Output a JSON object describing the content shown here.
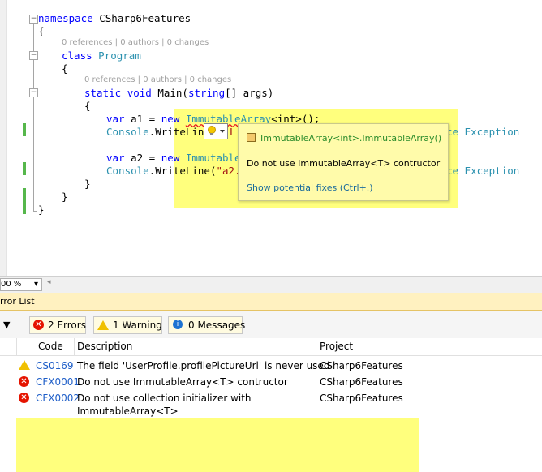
{
  "editor": {
    "lines": {
      "l1_kw": "namespace",
      "l1_name": " CSharp6Features",
      "l2": "{",
      "hint1": "0 references | 0 authors | 0 changes",
      "l3_kw": "class",
      "l3_name": "Program",
      "l4": "{",
      "hint2": "0 references | 0 authors | 0 changes",
      "l5_kw1": "static",
      "l5_kw2": "void",
      "l5_rest1": " Main(",
      "l5_kw3": "string",
      "l5_rest2": "[] args)",
      "l6": "{",
      "l7_kw1": "var",
      "l7_mid": " a1 = ",
      "l7_kw2": "new",
      "l7_type": "ImmutableArray",
      "l7_gen": "<int>",
      "l7_end": "();",
      "l8_type": "Console",
      "l8_mid": ".WriteLine",
      "l8_tail_l": "L",
      "l8_tail": "ce Exception",
      "l9_kw1": "var",
      "l9_mid": " a2 = ",
      "l9_kw2": "new",
      "l9_type": "ImmutableA",
      "l10_type": "Console",
      "l10_mid": ".WriteLine(",
      "l10_str": "\"a2.L",
      "l10_tail": "ce Exception",
      "l11": "}",
      "l12": "}",
      "l13": "}"
    },
    "popup": {
      "title": "ImmutableArray<int>.ImmutableArray()",
      "message": "Do not use ImmutableArray<T> contructor",
      "link": "Show potential fixes (Ctrl+.)"
    }
  },
  "status": {
    "zoom": "00 %"
  },
  "error_list": {
    "title": "rror List",
    "errors_button": "2 Errors",
    "warnings_button": "1 Warning",
    "messages_button": "0 Messages",
    "columns": {
      "code": "Code",
      "description": "Description",
      "project": "Project"
    },
    "rows": [
      {
        "code": "CS0169",
        "description": "The field 'UserProfile.profilePictureUrl' is never used",
        "project": "CSharp6Features"
      },
      {
        "code": "CFX0001",
        "description": "Do not use ImmutableArray<T> contructor",
        "project": "CSharp6Features"
      },
      {
        "code": "CFX0002",
        "description": "Do not use collection initializer with",
        "description2": "ImmutableArray<T>",
        "project": "CSharp6Features"
      }
    ]
  },
  "colors": {
    "highlight": "#ffff66",
    "error": "#e51400",
    "warning": "#f0c000",
    "change_bar": "#56b74b"
  }
}
